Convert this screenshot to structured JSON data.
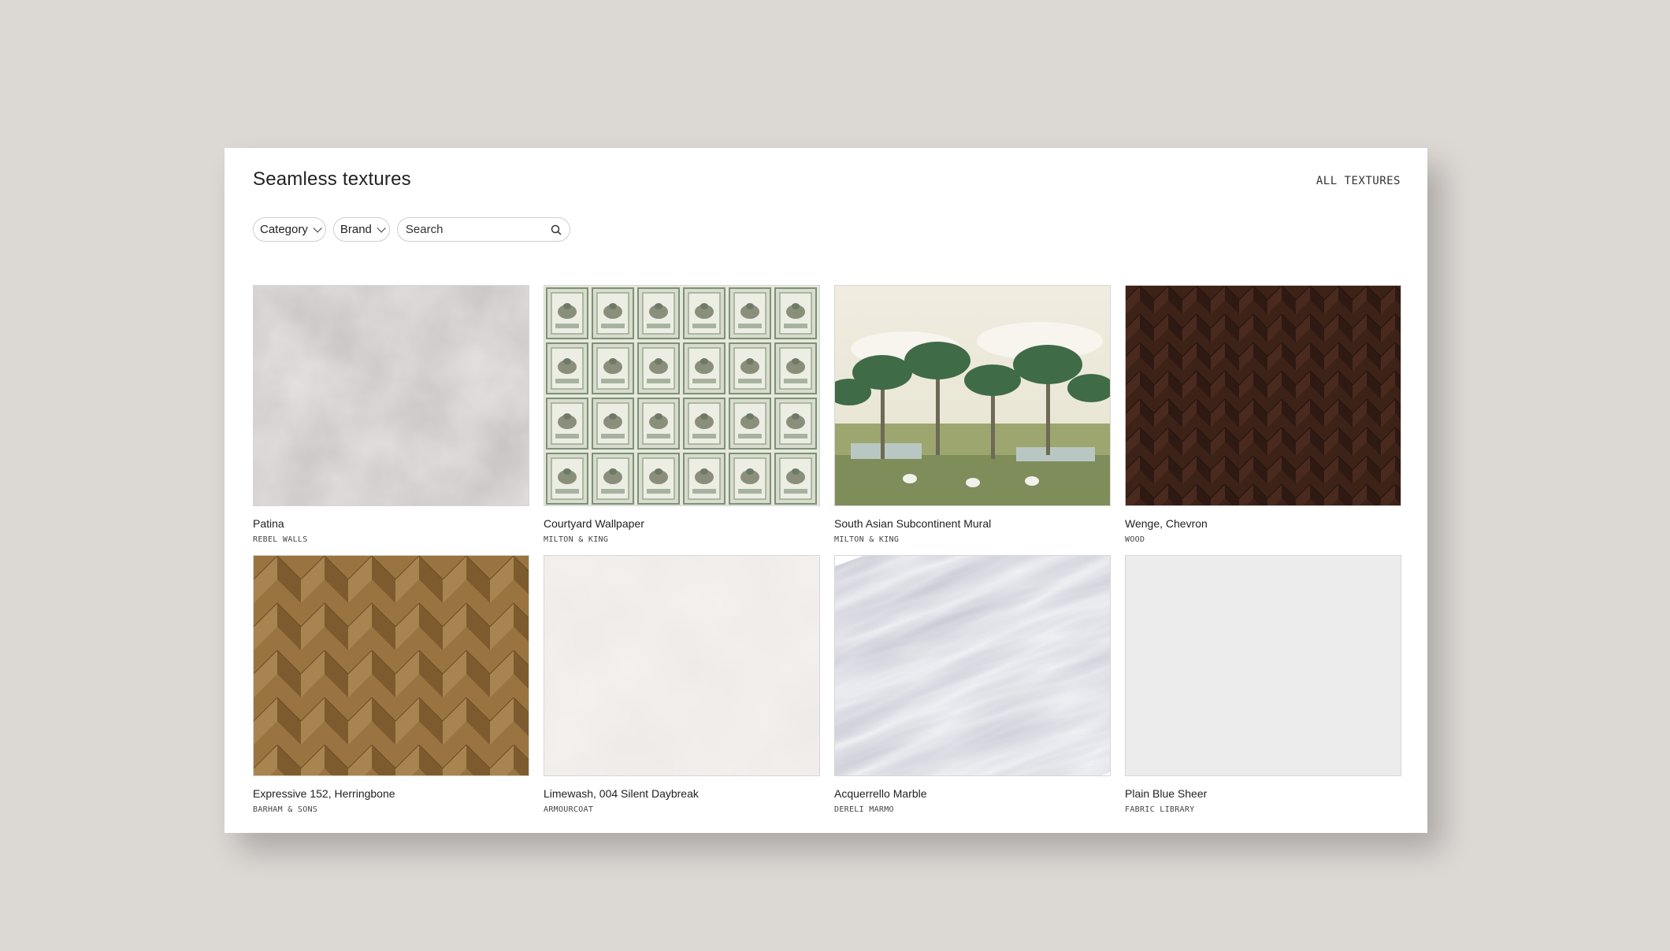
{
  "header": {
    "title": "Seamless textures",
    "all_link": "ALL TEXTURES"
  },
  "filters": {
    "category_label": "Category",
    "brand_label": "Brand",
    "search_placeholder": "Search"
  },
  "textures": [
    {
      "name": "Patina",
      "brand": "REBEL WALLS"
    },
    {
      "name": "Courtyard Wallpaper",
      "brand": "MILTON & KING"
    },
    {
      "name": "South Asian Subcontinent Mural",
      "brand": "MILTON & KING"
    },
    {
      "name": "Wenge, Chevron",
      "brand": "WOOD"
    },
    {
      "name": "Expressive 152, Herringbone",
      "brand": "BARHAM & SONS"
    },
    {
      "name": "Limewash, 004 Silent Daybreak",
      "brand": "ARMOURCOAT"
    },
    {
      "name": "Acquerrello Marble",
      "brand": "DERELI MARMO"
    },
    {
      "name": "Plain Blue Sheer",
      "brand": "FABRIC LIBRARY"
    }
  ]
}
